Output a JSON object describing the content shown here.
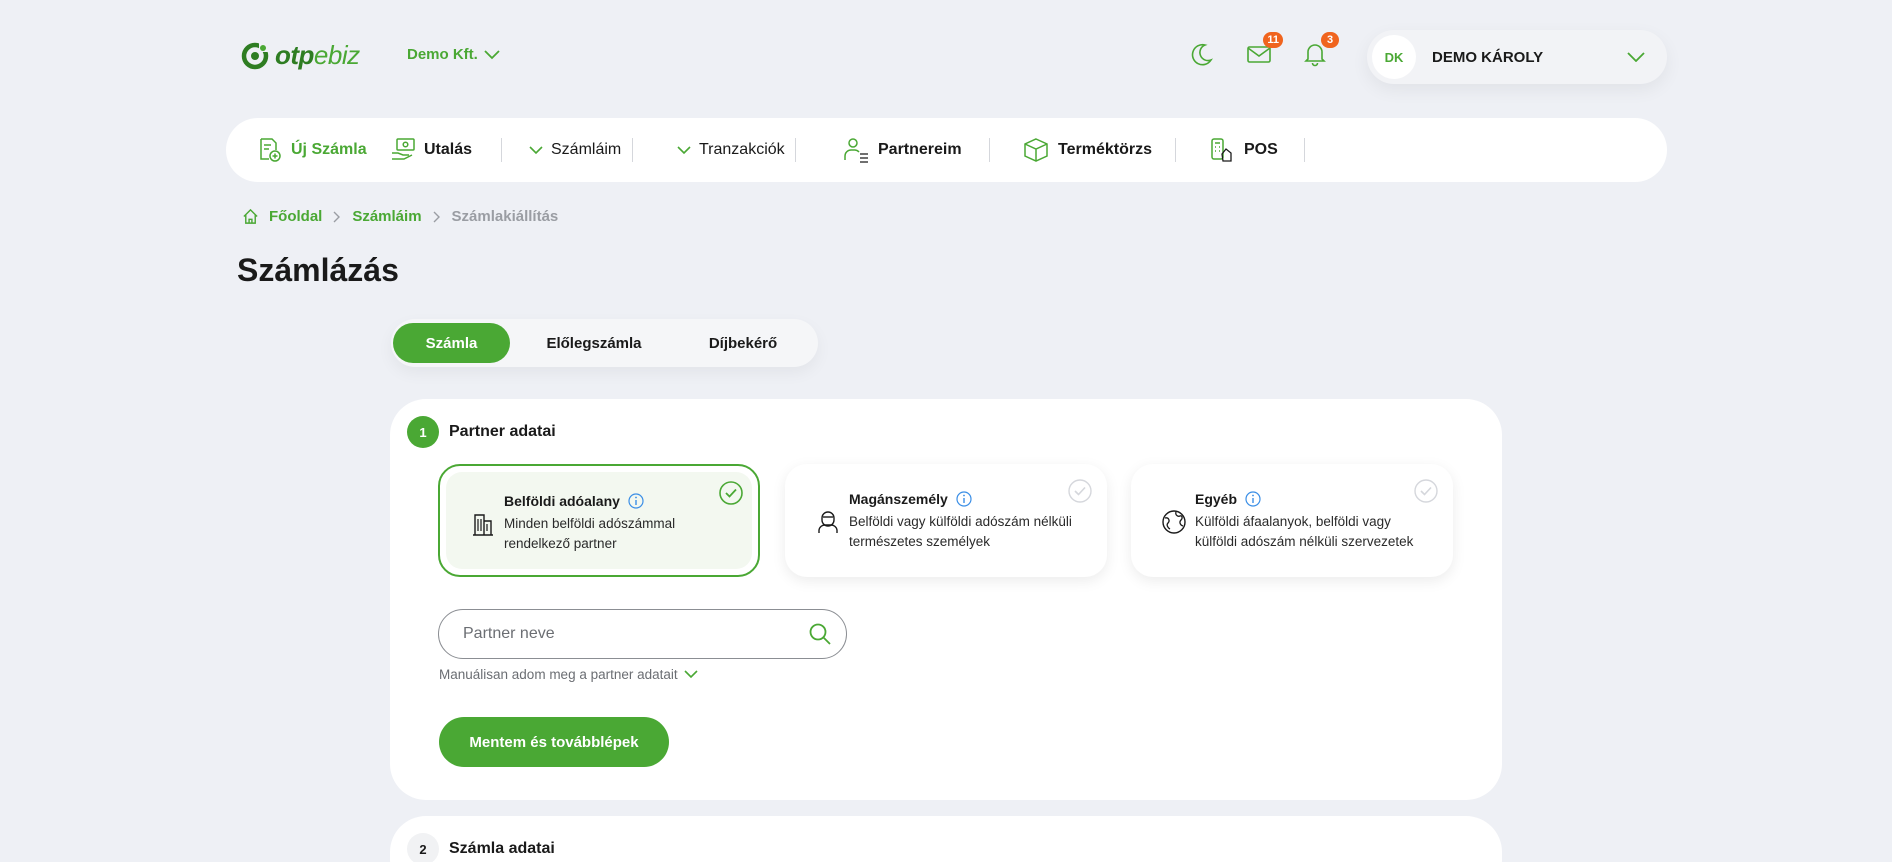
{
  "header": {
    "logo": {
      "part1": "otp",
      "part2": "ebiz"
    },
    "company": "Demo Kft.",
    "messages_badge": "11",
    "notifications_badge": "3",
    "user": {
      "initials": "DK",
      "name": "DEMO KÁROLY"
    }
  },
  "nav": {
    "new_invoice": "Új Számla",
    "transfer": "Utalás",
    "invoices": "Számláim",
    "transactions": "Tranzakciók",
    "partners": "Partnereim",
    "products": "Terméktörzs",
    "pos": "POS"
  },
  "breadcrumb": {
    "home": "Főoldal",
    "invoices": "Számláim",
    "current": "Számlakiállítás"
  },
  "page": {
    "title": "Számlázás"
  },
  "tabs": [
    {
      "label": "Számla",
      "active": true
    },
    {
      "label": "Előlegszámla",
      "active": false
    },
    {
      "label": "Díjbekérő",
      "active": false
    }
  ],
  "step1": {
    "number": "1",
    "title": "Partner adatai",
    "options": [
      {
        "title": "Belföldi adóalany",
        "desc": "Minden belföldi adószámmal rendelkező partner",
        "selected": true
      },
      {
        "title": "Magánszemély",
        "desc": "Belföldi vagy külföldi adószám nélküli természetes személyek",
        "selected": false
      },
      {
        "title": "Egyéb",
        "desc": "Külföldi áfaalanyok, belföldi vagy külföldi adószám nélküli szervezetek",
        "selected": false
      }
    ],
    "search_placeholder": "Partner neve",
    "manual_link": "Manuálisan adom meg a partner adatait",
    "submit": "Mentem és továbblépek"
  },
  "step2": {
    "number": "2",
    "title": "Számla adatai"
  },
  "colors": {
    "accent": "#4aa834",
    "badge": "#f0641e",
    "background": "#eef0f5"
  }
}
